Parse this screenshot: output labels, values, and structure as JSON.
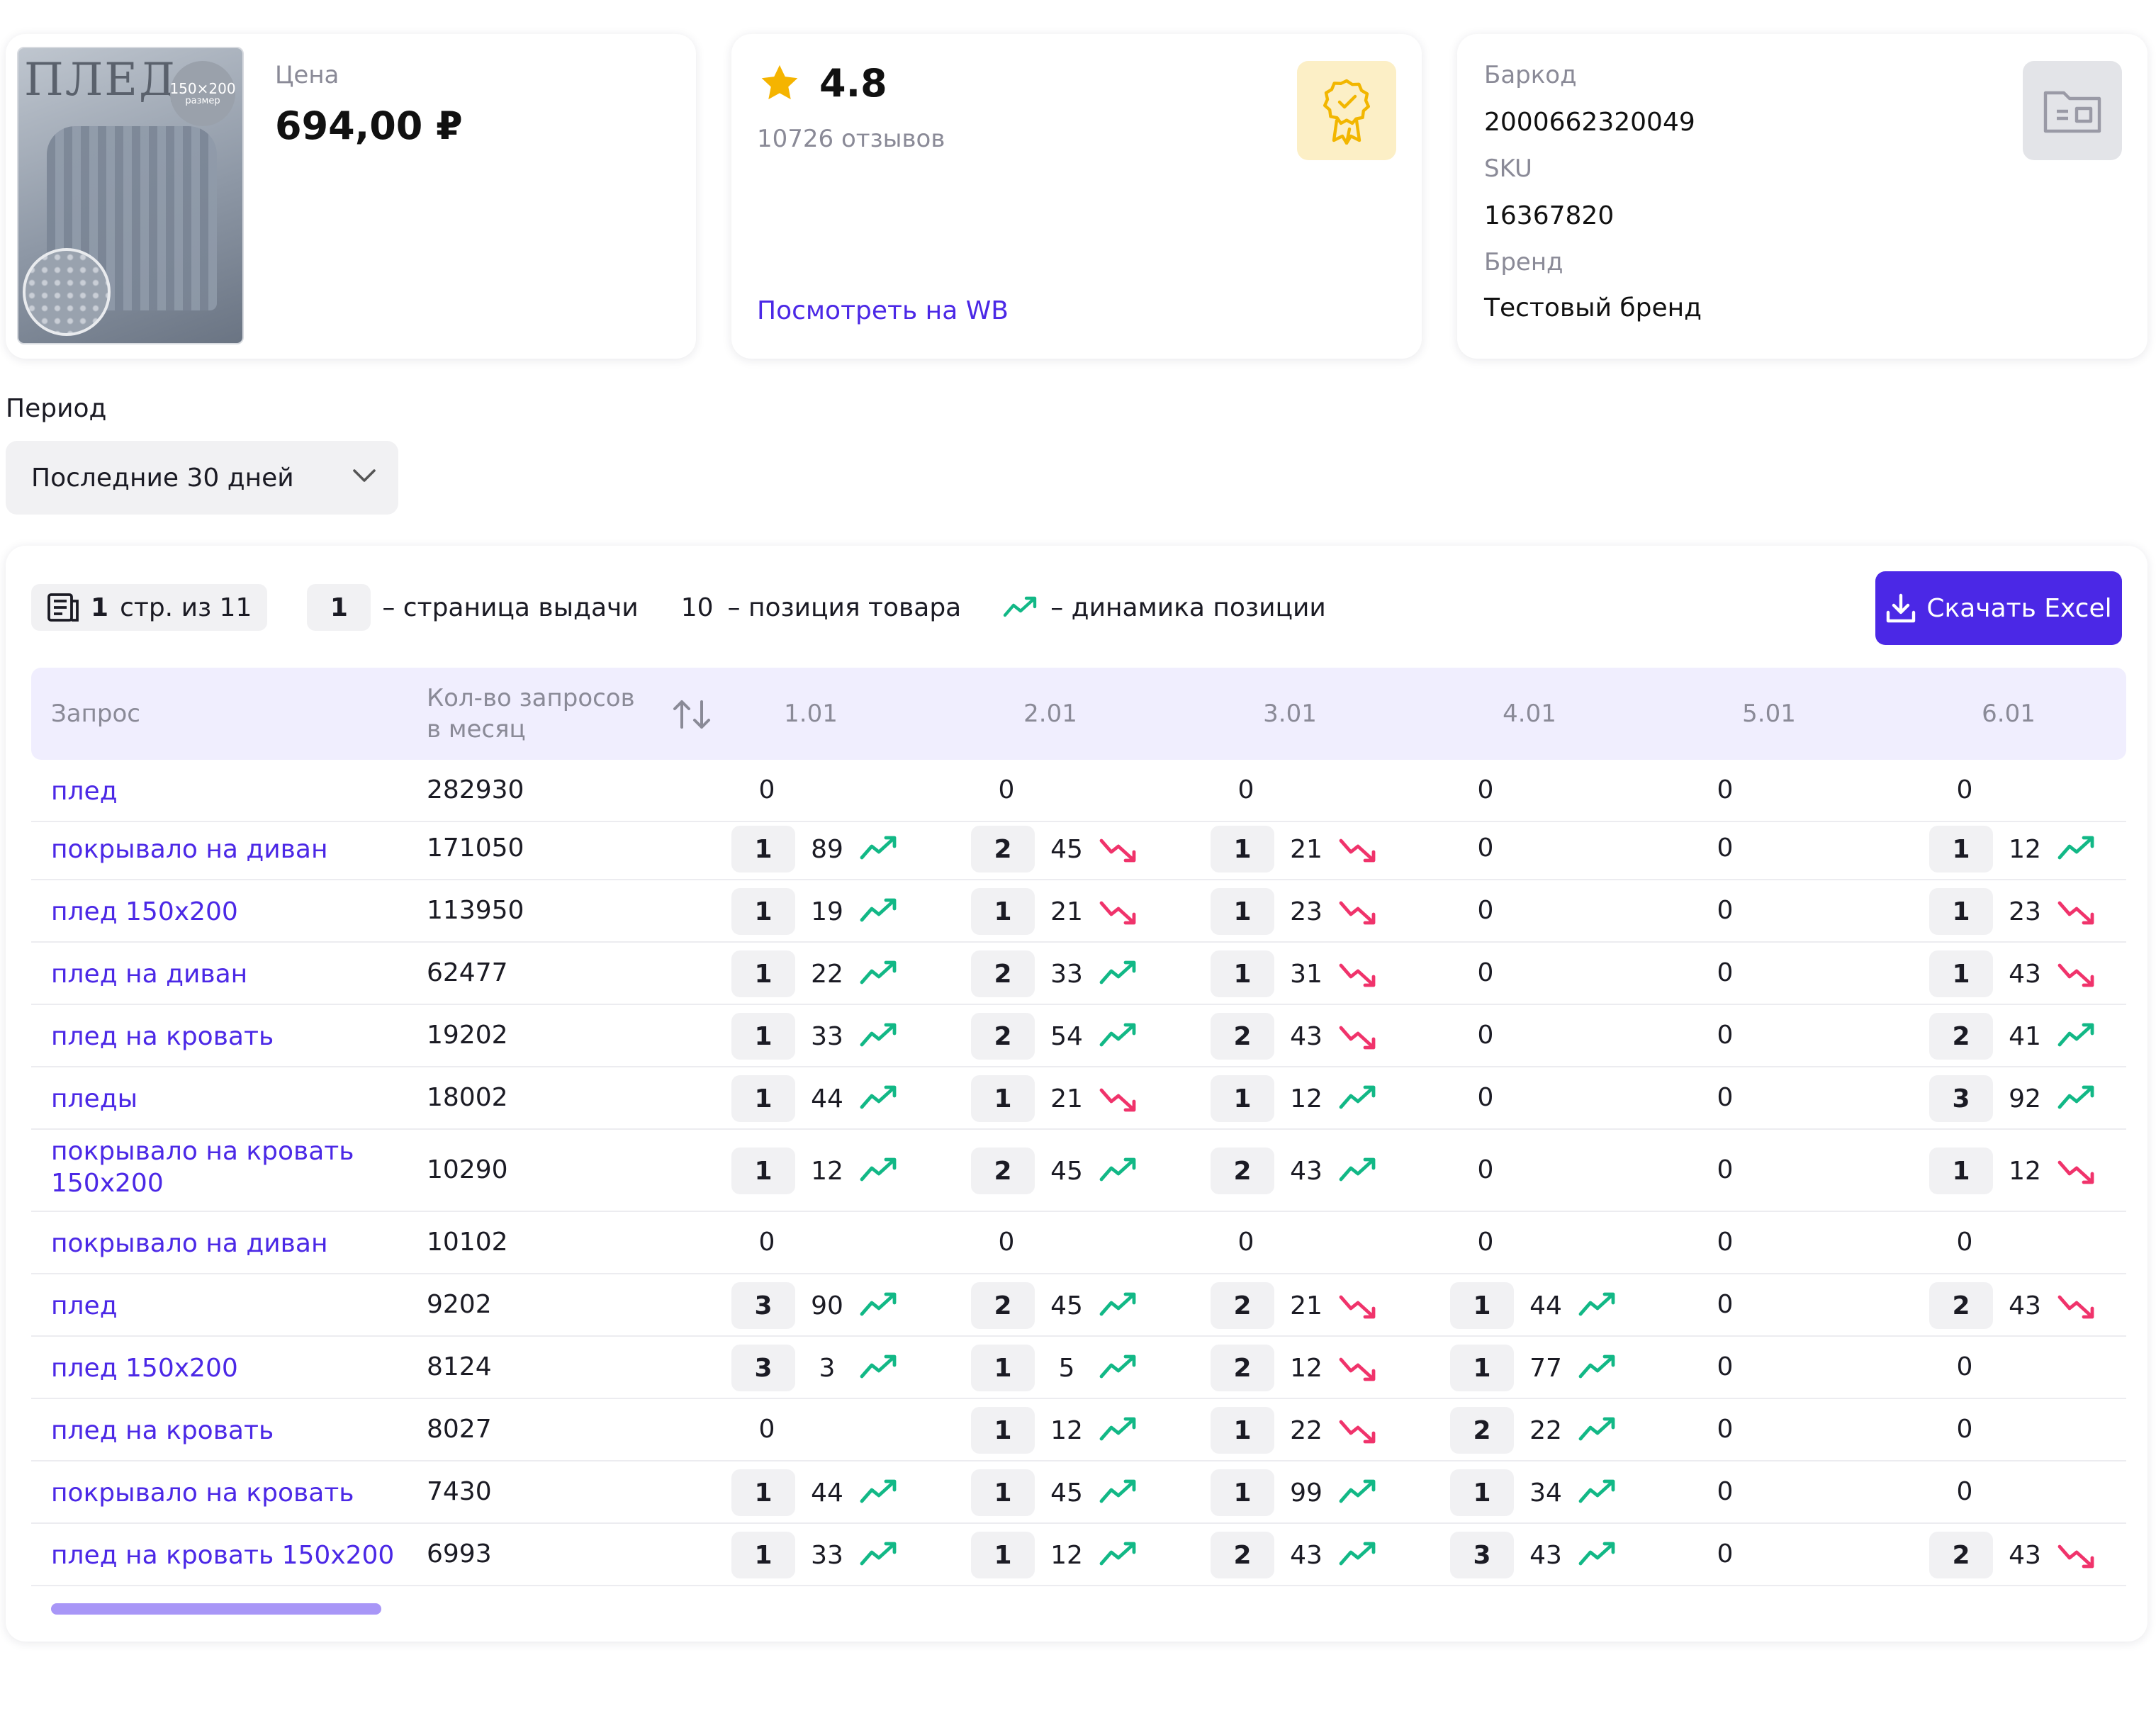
{
  "product": {
    "image_text": "ПЛЕД",
    "image_size": "150×200",
    "image_size_sub": "размер",
    "price_label": "Цена",
    "price_value": "694,00 ₽"
  },
  "rating": {
    "value": "4.8",
    "reviews": "10726 отзывов",
    "link": "Посмотреть на WB"
  },
  "info": {
    "barcode_label": "Баркод",
    "barcode_value": "2000662320049",
    "sku_label": "SKU",
    "sku_value": "16367820",
    "brand_label": "Бренд",
    "brand_value": "Тестовый бренд"
  },
  "period": {
    "label": "Период",
    "selected": "Последние 30 дней"
  },
  "toolbar": {
    "page_num": "1",
    "page_text": "стр. из 11",
    "legend_page_num": "1",
    "legend_page_text": "– страница выдачи",
    "legend_pos_num": "10",
    "legend_pos_text": "–  позиция товара",
    "legend_trend_text": "–  динамика позиции",
    "excel_label": "Скачать Excel"
  },
  "table": {
    "col_query": "Запрос",
    "col_count_line1": "Кол-во запросов",
    "col_count_line2": "в месяц",
    "dates": [
      "1.01",
      "2.01",
      "3.01",
      "4.01",
      "5.01",
      "6.01"
    ],
    "rows": [
      {
        "q": "плед",
        "count": "282930",
        "cells": [
          [
            "0"
          ],
          [
            "0"
          ],
          [
            "0"
          ],
          [
            "0"
          ],
          [
            "0"
          ],
          [
            "0"
          ]
        ]
      },
      {
        "q": "покрывало на диван",
        "count": "171050",
        "cells": [
          [
            "1",
            "89",
            "up"
          ],
          [
            "2",
            "45",
            "down"
          ],
          [
            "1",
            "21",
            "down"
          ],
          [
            "0"
          ],
          [
            "0"
          ],
          [
            "1",
            "12",
            "up"
          ]
        ]
      },
      {
        "q": "плед 150х200",
        "count": "113950",
        "cells": [
          [
            "1",
            "19",
            "up"
          ],
          [
            "1",
            "21",
            "down"
          ],
          [
            "1",
            "23",
            "down"
          ],
          [
            "0"
          ],
          [
            "0"
          ],
          [
            "1",
            "23",
            "down"
          ]
        ]
      },
      {
        "q": "плед на диван",
        "count": "62477",
        "cells": [
          [
            "1",
            "22",
            "up"
          ],
          [
            "2",
            "33",
            "up"
          ],
          [
            "1",
            "31",
            "down"
          ],
          [
            "0"
          ],
          [
            "0"
          ],
          [
            "1",
            "43",
            "down"
          ]
        ]
      },
      {
        "q": "плед на кровать",
        "count": "19202",
        "cells": [
          [
            "1",
            "33",
            "up"
          ],
          [
            "2",
            "54",
            "up"
          ],
          [
            "2",
            "43",
            "down"
          ],
          [
            "0"
          ],
          [
            "0"
          ],
          [
            "2",
            "41",
            "up"
          ]
        ]
      },
      {
        "q": "пледы",
        "count": "18002",
        "cells": [
          [
            "1",
            "44",
            "up"
          ],
          [
            "1",
            "21",
            "down"
          ],
          [
            "1",
            "12",
            "up"
          ],
          [
            "0"
          ],
          [
            "0"
          ],
          [
            "3",
            "92",
            "up"
          ]
        ]
      },
      {
        "q": "покрывало на кровать 150х200",
        "count": "10290",
        "cells": [
          [
            "1",
            "12",
            "up"
          ],
          [
            "2",
            "45",
            "up"
          ],
          [
            "2",
            "43",
            "up"
          ],
          [
            "0"
          ],
          [
            "0"
          ],
          [
            "1",
            "12",
            "down"
          ]
        ]
      },
      {
        "q": "покрывало на диван",
        "count": "10102",
        "cells": [
          [
            "0"
          ],
          [
            "0"
          ],
          [
            "0"
          ],
          [
            "0"
          ],
          [
            "0"
          ],
          [
            "0"
          ]
        ]
      },
      {
        "q": "плед",
        "count": "9202",
        "cells": [
          [
            "3",
            "90",
            "up"
          ],
          [
            "2",
            "45",
            "up"
          ],
          [
            "2",
            "21",
            "down"
          ],
          [
            "1",
            "44",
            "up"
          ],
          [
            "0"
          ],
          [
            "2",
            "43",
            "down"
          ]
        ]
      },
      {
        "q": "плед 150х200",
        "count": "8124",
        "cells": [
          [
            "3",
            "3",
            "up"
          ],
          [
            "1",
            "5",
            "up"
          ],
          [
            "2",
            "12",
            "down"
          ],
          [
            "1",
            "77",
            "up"
          ],
          [
            "0"
          ],
          [
            "0"
          ]
        ]
      },
      {
        "q": "плед на кровать",
        "count": "8027",
        "cells": [
          [
            "0"
          ],
          [
            "1",
            "12",
            "up"
          ],
          [
            "1",
            "22",
            "down"
          ],
          [
            "2",
            "22",
            "up"
          ],
          [
            "0"
          ],
          [
            "0"
          ]
        ]
      },
      {
        "q": "покрывало на кровать",
        "count": "7430",
        "cells": [
          [
            "1",
            "44",
            "up"
          ],
          [
            "1",
            "45",
            "up"
          ],
          [
            "1",
            "99",
            "up"
          ],
          [
            "1",
            "34",
            "up"
          ],
          [
            "0"
          ],
          [
            "0"
          ]
        ]
      },
      {
        "q": "плед на кровать 150х200",
        "count": "6993",
        "cells": [
          [
            "1",
            "33",
            "up"
          ],
          [
            "1",
            "12",
            "up"
          ],
          [
            "2",
            "43",
            "up"
          ],
          [
            "3",
            "43",
            "up"
          ],
          [
            "0"
          ],
          [
            "2",
            "43",
            "down"
          ]
        ]
      }
    ]
  },
  "colors": {
    "accent": "#4b28e6",
    "trend_up": "#12b886",
    "trend_down": "#f0336b",
    "header_bg": "#f0eefe"
  }
}
